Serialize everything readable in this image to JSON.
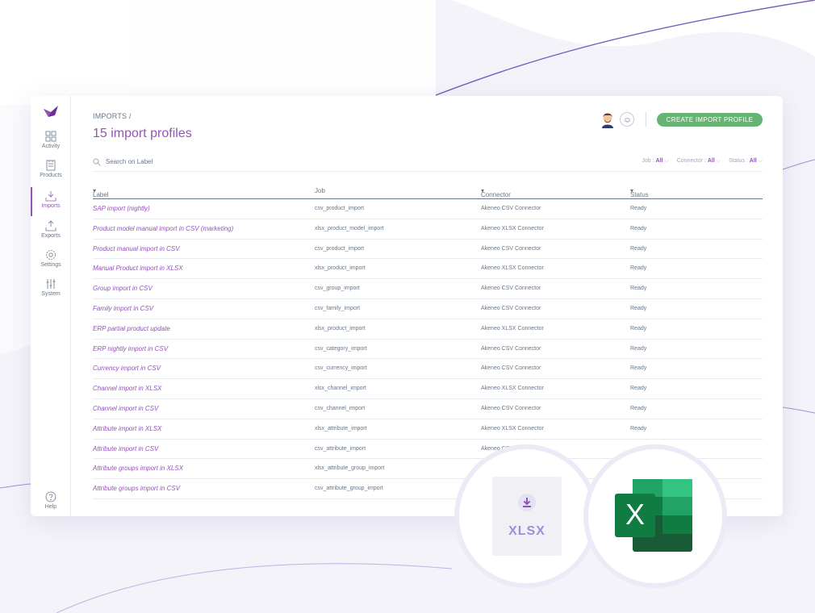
{
  "colors": {
    "accent": "#9452ba",
    "primary_button": "#67b373",
    "text": "#67768a"
  },
  "sidebar": {
    "items": [
      {
        "label": "Activity",
        "icon": "activity-icon"
      },
      {
        "label": "Products",
        "icon": "products-icon"
      },
      {
        "label": "Imports",
        "icon": "imports-icon",
        "active": true
      },
      {
        "label": "Exports",
        "icon": "exports-icon"
      },
      {
        "label": "Settings",
        "icon": "settings-icon"
      },
      {
        "label": "System",
        "icon": "system-icon"
      }
    ],
    "help_label": "Help"
  },
  "header": {
    "breadcrumb": "IMPORTS /",
    "title": "15 import profiles",
    "create_button": "CREATE IMPORT PROFILE"
  },
  "search": {
    "placeholder": "Search on Label"
  },
  "filters": [
    {
      "label": "Job :",
      "value": "All"
    },
    {
      "label": "Connector :",
      "value": "All"
    },
    {
      "label": "Status :",
      "value": "All"
    }
  ],
  "table": {
    "columns": [
      "Label",
      "Job",
      "Connector",
      "Status"
    ],
    "rows": [
      {
        "label": "SAP import (nightly)",
        "job": "csv_product_import",
        "connector": "Akeneo CSV Connector",
        "status": "Ready"
      },
      {
        "label": "Product model manual import in CSV (marketing)",
        "job": "xlsx_product_model_import",
        "connector": "Akeneo XLSX Connector",
        "status": "Ready"
      },
      {
        "label": "Product manual import in CSV",
        "job": "csv_product_import",
        "connector": "Akeneo CSV Connector",
        "status": "Ready"
      },
      {
        "label": "Manual Product import in XLSX",
        "job": "xlsx_product_import",
        "connector": "Akeneo XLSX Connector",
        "status": "Ready"
      },
      {
        "label": "Group import in CSV",
        "job": "csv_group_import",
        "connector": "Akeneo CSV Connector",
        "status": "Ready"
      },
      {
        "label": "Family import in CSV",
        "job": "csv_family_import",
        "connector": "Akeneo CSV Connector",
        "status": "Ready"
      },
      {
        "label": "ERP partial product update",
        "job": "xlsx_product_import",
        "connector": "Akeneo XLSX Connector",
        "status": "Ready"
      },
      {
        "label": "ERP nightly import in CSV",
        "job": "csv_category_import",
        "connector": "Akeneo CSV Connector",
        "status": "Ready"
      },
      {
        "label": "Currency import in CSV",
        "job": "csv_currency_import",
        "connector": "Akeneo CSV Connector",
        "status": "Ready"
      },
      {
        "label": "Channel import in XLSX",
        "job": "xlsx_channel_import",
        "connector": "Akeneo XLSX Connector",
        "status": "Ready"
      },
      {
        "label": "Channel import in CSV",
        "job": "csv_channel_import",
        "connector": "Akeneo CSV Connector",
        "status": "Ready"
      },
      {
        "label": "Attribute import in XLSX",
        "job": "xlsx_attribute_import",
        "connector": "Akeneo XLSX Connector",
        "status": "Ready"
      },
      {
        "label": "Attribute import in CSV",
        "job": "csv_attribute_import",
        "connector": "Akeneo CSV Connector",
        "status": ""
      },
      {
        "label": "Attribute groups import in XLSX",
        "job": "xlsx_attribute_group_import",
        "connector": "",
        "status": ""
      },
      {
        "label": "Attribute groups import in CSV",
        "job": "csv_attribute_group_import",
        "connector": "",
        "status": ""
      }
    ]
  },
  "overlay": {
    "xlsx_label": "XLSX",
    "excel_letter": "X"
  }
}
